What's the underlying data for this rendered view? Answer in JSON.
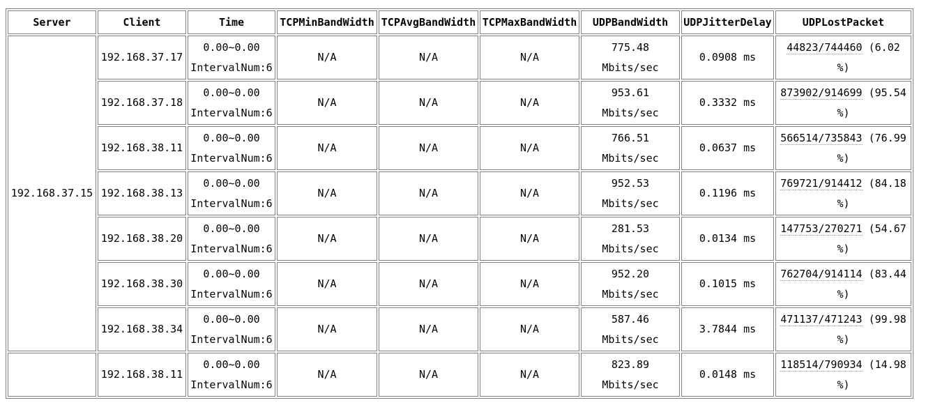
{
  "headers": {
    "server": "Server",
    "client": "Client",
    "time": "Time",
    "tcp_min": "TCPMinBandWidth",
    "tcp_avg": "TCPAvgBandWidth",
    "tcp_max": "TCPMaxBandWidth",
    "udp_bw": "UDPBandWidth",
    "udp_jitter": "UDPJitterDelay",
    "udp_lost": "UDPLostPacket"
  },
  "groups": [
    {
      "server": "192.168.37.15",
      "rows": [
        {
          "client": "192.168.37.17",
          "time_range": "0.00~0.00",
          "interval": "IntervalNum:6",
          "tcp_min": "N/A",
          "tcp_avg": "N/A",
          "tcp_max": "N/A",
          "udp_bw_value": "775.48",
          "udp_bw_unit": "Mbits/sec",
          "udp_jitter": "0.0908 ms",
          "lost": "44823/744460",
          "lost_pct_a": "(6.02",
          "lost_pct_b": "%)"
        },
        {
          "client": "192.168.37.18",
          "time_range": "0.00~0.00",
          "interval": "IntervalNum:6",
          "tcp_min": "N/A",
          "tcp_avg": "N/A",
          "tcp_max": "N/A",
          "udp_bw_value": "953.61",
          "udp_bw_unit": "Mbits/sec",
          "udp_jitter": "0.3332 ms",
          "lost": "873902/914699",
          "lost_pct_a": "(95.54",
          "lost_pct_b": "%)"
        },
        {
          "client": "192.168.38.11",
          "time_range": "0.00~0.00",
          "interval": "IntervalNum:6",
          "tcp_min": "N/A",
          "tcp_avg": "N/A",
          "tcp_max": "N/A",
          "udp_bw_value": "766.51",
          "udp_bw_unit": "Mbits/sec",
          "udp_jitter": "0.0637 ms",
          "lost": "566514/735843",
          "lost_pct_a": "(76.99",
          "lost_pct_b": "%)"
        },
        {
          "client": "192.168.38.13",
          "time_range": "0.00~0.00",
          "interval": "IntervalNum:6",
          "tcp_min": "N/A",
          "tcp_avg": "N/A",
          "tcp_max": "N/A",
          "udp_bw_value": "952.53",
          "udp_bw_unit": "Mbits/sec",
          "udp_jitter": "0.1196 ms",
          "lost": "769721/914412",
          "lost_pct_a": "(84.18",
          "lost_pct_b": "%)"
        },
        {
          "client": "192.168.38.20",
          "time_range": "0.00~0.00",
          "interval": "IntervalNum:6",
          "tcp_min": "N/A",
          "tcp_avg": "N/A",
          "tcp_max": "N/A",
          "udp_bw_value": "281.53",
          "udp_bw_unit": "Mbits/sec",
          "udp_jitter": "0.0134 ms",
          "lost": "147753/270271",
          "lost_pct_a": "(54.67",
          "lost_pct_b": "%)"
        },
        {
          "client": "192.168.38.30",
          "time_range": "0.00~0.00",
          "interval": "IntervalNum:6",
          "tcp_min": "N/A",
          "tcp_avg": "N/A",
          "tcp_max": "N/A",
          "udp_bw_value": "952.20",
          "udp_bw_unit": "Mbits/sec",
          "udp_jitter": "0.1015 ms",
          "lost": "762704/914114",
          "lost_pct_a": "(83.44",
          "lost_pct_b": "%)"
        },
        {
          "client": "192.168.38.34",
          "time_range": "0.00~0.00",
          "interval": "IntervalNum:6",
          "tcp_min": "N/A",
          "tcp_avg": "N/A",
          "tcp_max": "N/A",
          "udp_bw_value": "587.46",
          "udp_bw_unit": "Mbits/sec",
          "udp_jitter": "3.7844 ms",
          "lost": "471137/471243",
          "lost_pct_a": "(99.98",
          "lost_pct_b": "%)"
        }
      ]
    },
    {
      "server": "",
      "rows": [
        {
          "client": "192.168.38.11",
          "time_range": "0.00~0.00",
          "interval": "IntervalNum:6",
          "tcp_min": "N/A",
          "tcp_avg": "N/A",
          "tcp_max": "N/A",
          "udp_bw_value": "823.89",
          "udp_bw_unit": "Mbits/sec",
          "udp_jitter": "0.0148 ms",
          "lost": "118514/790934",
          "lost_pct_a": "(14.98",
          "lost_pct_b": "%)"
        }
      ]
    }
  ]
}
